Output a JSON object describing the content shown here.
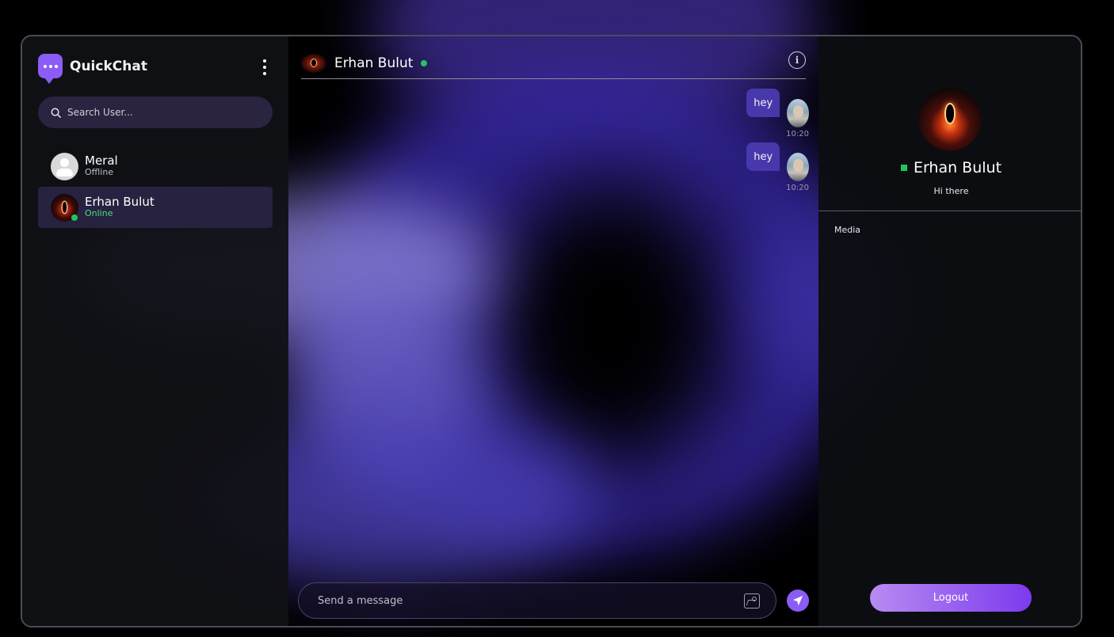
{
  "brand": {
    "name": "QuickChat",
    "icon": "chat-bubble-icon",
    "accent": "#8b5cf6"
  },
  "sidebar": {
    "search_placeholder": "Search User...",
    "users": [
      {
        "name": "Meral",
        "status": "Offline",
        "avatar": "default-user-icon"
      },
      {
        "name": "Erhan Bulut",
        "status": "Online",
        "avatar": "eclipse-avatar",
        "active": true
      }
    ]
  },
  "chat": {
    "contact_name": "Erhan Bulut",
    "contact_online": true,
    "messages": [
      {
        "text": "hey",
        "time": "10:20"
      },
      {
        "text": "hey",
        "time": "10:20"
      }
    ],
    "composer_placeholder": "Send a message",
    "icons": {
      "info": "info-icon",
      "gallery": "gallery-icon",
      "send": "send-icon"
    }
  },
  "details": {
    "name": "Erhan Bulut",
    "bio": "Hi there",
    "media_label": "Media",
    "logout_label": "Logout"
  },
  "colors": {
    "online": "#22c55e",
    "bubble": "#4a3ab0",
    "active_row": "#272240"
  }
}
